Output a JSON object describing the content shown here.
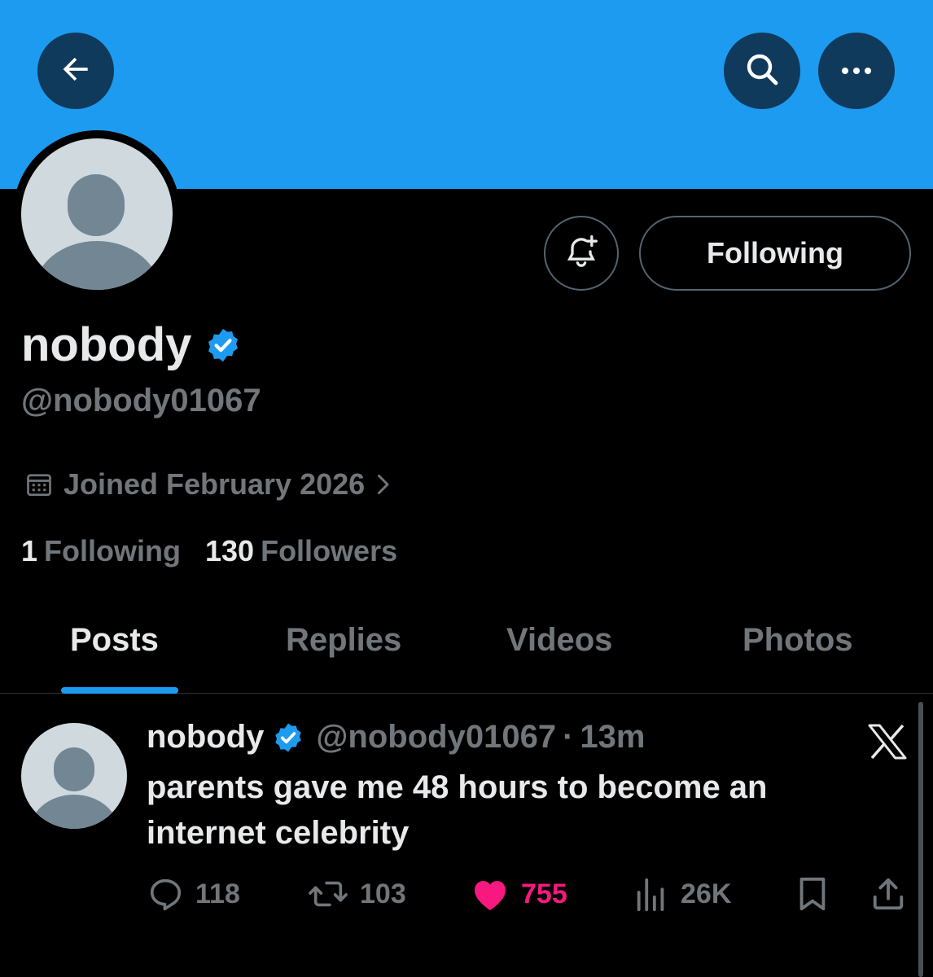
{
  "header": {
    "back_icon": "arrow-left-icon",
    "search_icon": "search-icon",
    "more_icon": "more-horizontal-icon",
    "banner_color": "#1d9bf0"
  },
  "profile": {
    "display_name": "nobody",
    "handle": "@nobody01067",
    "verified": true,
    "joined": "Joined February 2026",
    "follow_button_label": "Following",
    "notify_icon": "bell-plus-icon",
    "stats": {
      "following_count": "1",
      "following_label": "Following",
      "followers_count": "130",
      "followers_label": "Followers"
    }
  },
  "tabs": [
    {
      "label": "Posts",
      "active": true
    },
    {
      "label": "Replies",
      "active": false
    },
    {
      "label": "Videos",
      "active": false
    },
    {
      "label": "Photos",
      "active": false
    }
  ],
  "post": {
    "author_name": "nobody",
    "author_handle": "@nobody01067",
    "separator": "·",
    "time": "13m",
    "text": "parents gave me 48 hours to become an internet celebrity",
    "reply_count": "118",
    "repost_count": "103",
    "like_count": "755",
    "view_count": "26K",
    "liked": true,
    "like_color": "#f91880",
    "source_icon": "x-logo-icon"
  },
  "colors": {
    "accent": "#1d9bf0",
    "muted_text": "#71767b",
    "primary_text": "#e7e9ea",
    "background": "#000000"
  }
}
